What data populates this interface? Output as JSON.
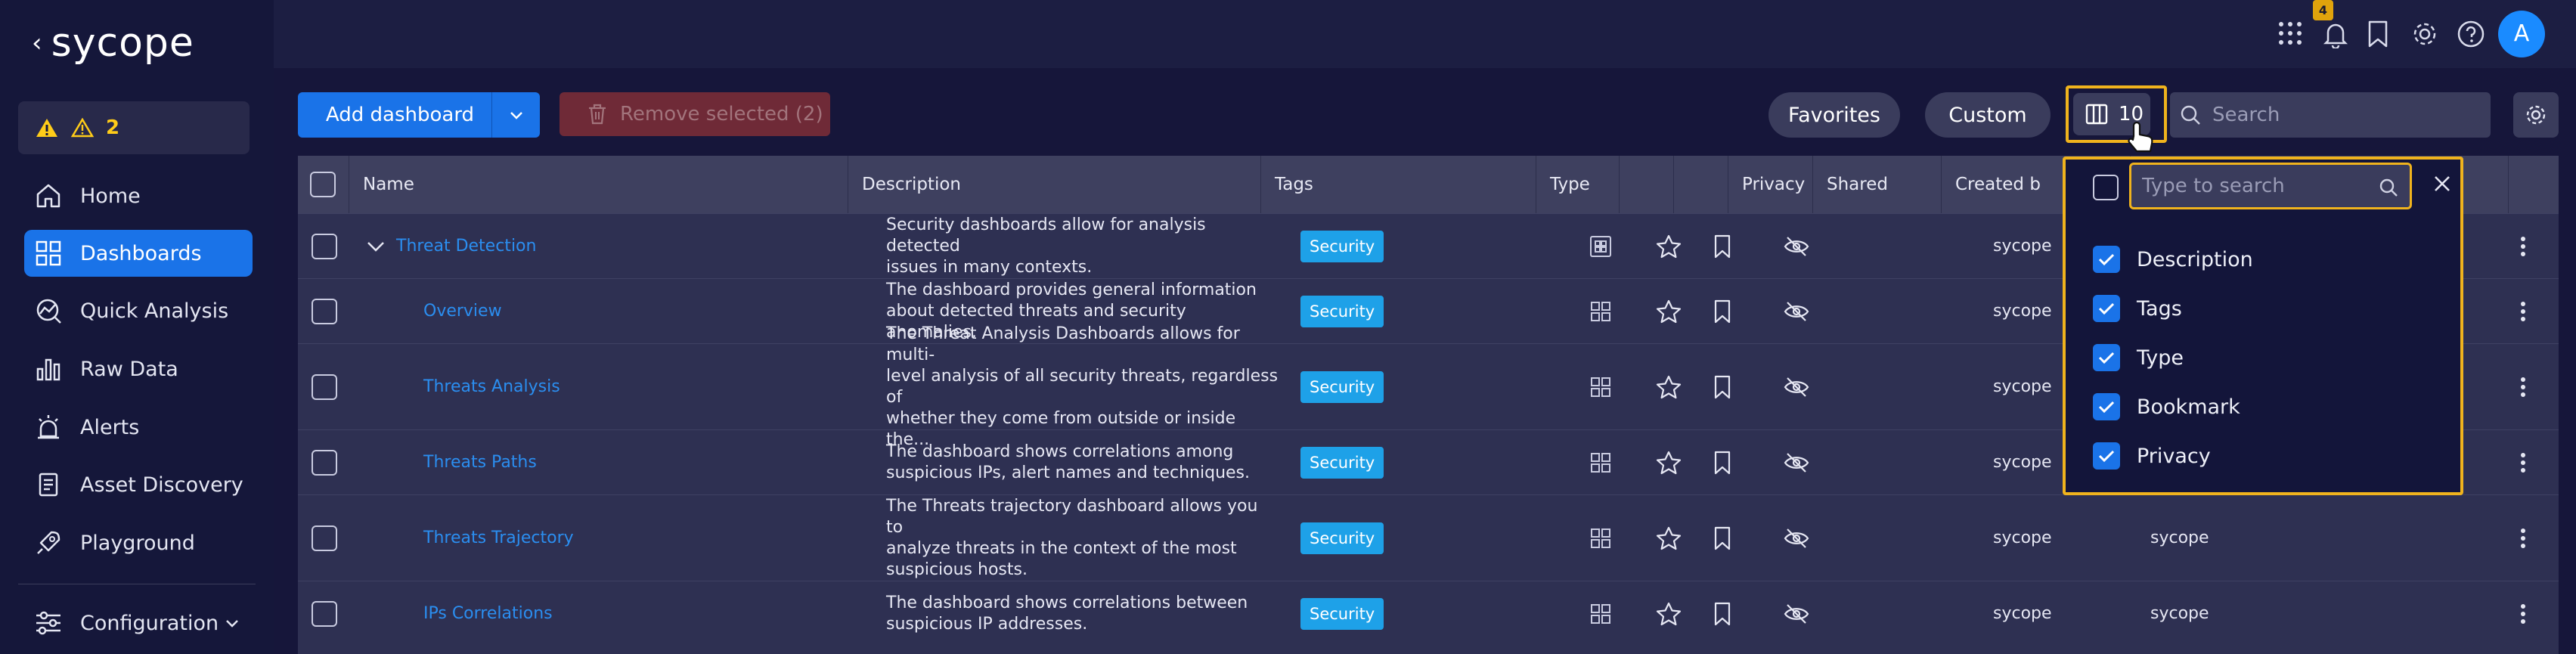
{
  "app": {
    "brand": "sycope",
    "back_symbol": "‹"
  },
  "alerts_summary": {
    "count": "2"
  },
  "sidebar": {
    "items": [
      {
        "label": "Home",
        "icon": "home-icon"
      },
      {
        "label": "Dashboards",
        "icon": "dashboards-icon",
        "active": true
      },
      {
        "label": "Quick Analysis",
        "icon": "quick-analysis-icon"
      },
      {
        "label": "Raw Data",
        "icon": "raw-data-icon"
      },
      {
        "label": "Alerts",
        "icon": "alarm-icon"
      },
      {
        "label": "Asset Discovery",
        "icon": "asset-discovery-icon"
      },
      {
        "label": "Playground",
        "icon": "rocket-icon"
      },
      {
        "label": "Configuration",
        "icon": "sliders-icon"
      }
    ]
  },
  "topbar": {
    "notifications_count": "4",
    "avatar_initial": "A"
  },
  "toolbar": {
    "add_dashboard": "Add dashboard",
    "remove_selected": "Remove selected (2)",
    "favorites": "Favorites",
    "custom": "Custom",
    "columns_count": "10",
    "search_placeholder": "Search"
  },
  "table": {
    "columns": [
      "Name",
      "Description",
      "Tags",
      "Type",
      "",
      "",
      "Privacy",
      "Shared",
      "Created b",
      ""
    ],
    "rows": [
      {
        "name": "Threat Detection",
        "desc": [
          "Security dashboards allow for analysis detected",
          "issues in many contexts."
        ],
        "tag": "Security",
        "created": "sycope",
        "extra": ""
      },
      {
        "name": "Overview",
        "desc": [
          "The dashboard provides general information",
          "about detected threats and security anomalies."
        ],
        "tag": "Security",
        "created": "sycope",
        "extra": ""
      },
      {
        "name": "Threats Analysis",
        "desc": [
          "The Threat Analysis Dashboards allows for multi-",
          "level analysis of all security threats, regardless of",
          "whether they come from outside or inside the..."
        ],
        "tag": "Security",
        "created": "sycope",
        "extra": ""
      },
      {
        "name": "Threats Paths",
        "desc": [
          "The dashboard shows correlations among",
          "suspicious IPs, alert names and techniques."
        ],
        "tag": "Security",
        "created": "sycope",
        "extra": ""
      },
      {
        "name": "Threats Trajectory",
        "desc": [
          "The Threats trajectory dashboard allows you to",
          "analyze threats in the context of the most",
          "suspicious hosts."
        ],
        "tag": "Security",
        "created": "sycope",
        "extra": "sycope"
      },
      {
        "name": "IPs Correlations",
        "desc": [
          "The dashboard shows correlations between",
          "suspicious IP addresses."
        ],
        "tag": "Security",
        "created": "sycope",
        "extra": "sycope"
      }
    ]
  },
  "column_picker": {
    "search_placeholder": "Type to search",
    "options": [
      {
        "label": "Description",
        "checked": true
      },
      {
        "label": "Tags",
        "checked": true
      },
      {
        "label": "Type",
        "checked": true
      },
      {
        "label": "Bookmark",
        "checked": true
      },
      {
        "label": "Privacy",
        "checked": true
      }
    ]
  },
  "colors": {
    "accent": "#1a73e8",
    "highlight": "#f0b31d",
    "tag": "#1ea1e8",
    "warning": "#ffcc19",
    "link": "#2b8ef0"
  }
}
